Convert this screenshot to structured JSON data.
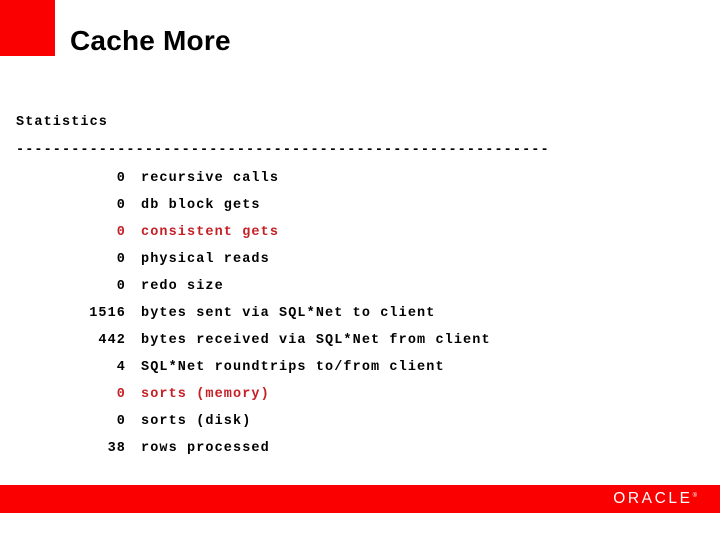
{
  "slide": {
    "title": "Cache More",
    "accent_color": "#fa0000",
    "background_color": "#ffffff"
  },
  "console": {
    "heading": "Statistics",
    "rule": "----------------------------------------------------------",
    "highlight_color": "#c42026",
    "default_color": "#000000",
    "rows": [
      {
        "value": "0",
        "label": "recursive calls",
        "highlight": false
      },
      {
        "value": "0",
        "label": "db block gets",
        "highlight": false
      },
      {
        "value": "0",
        "label": "consistent gets",
        "highlight": true
      },
      {
        "value": "0",
        "label": "physical reads",
        "highlight": false
      },
      {
        "value": "0",
        "label": "redo size",
        "highlight": false
      },
      {
        "value": "1516",
        "label": "bytes sent via SQL*Net to client",
        "highlight": false
      },
      {
        "value": "442",
        "label": "bytes received via SQL*Net from client",
        "highlight": false
      },
      {
        "value": "4",
        "label": "SQL*Net roundtrips to/from client",
        "highlight": false
      },
      {
        "value": "0",
        "label": "sorts (memory)",
        "highlight": true
      },
      {
        "value": "0",
        "label": "sorts (disk)",
        "highlight": false
      },
      {
        "value": "38",
        "label": "rows processed",
        "highlight": false
      }
    ]
  },
  "footer": {
    "bar_color": "#fa0000",
    "logo_text": "ORACLE",
    "logo_trademark": "®"
  }
}
